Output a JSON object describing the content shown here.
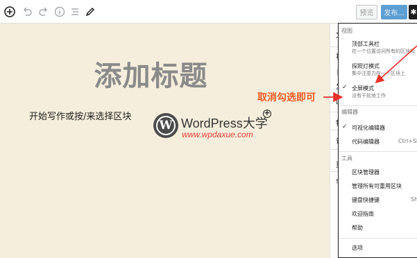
{
  "toolbar": {
    "icons": [
      "add-block-icon",
      "undo-icon",
      "redo-icon",
      "info-icon",
      "list-view-icon",
      "edit-icon"
    ],
    "preview_label": "预览",
    "publish_label": "发布...",
    "settings_icon": "gear-icon"
  },
  "editor": {
    "title_placeholder": "添加标题",
    "paragraph_placeholder": "开始写作或按/来选择区块",
    "add_block_symbol": "+"
  },
  "watermark": {
    "logo_letter": "W",
    "name": "WordPress大学",
    "url": "www.wpdaxue.com"
  },
  "annotation": {
    "text": "取消勾选即可",
    "color": "#f15a22"
  },
  "sidebar": {
    "fragments": [
      "文",
      "状",
      "台",
      "发",
      "[",
      "特",
      "讨",
      "页",
      "S"
    ]
  },
  "menu": {
    "groups": [
      {
        "label": "视图",
        "items": [
          {
            "label": "顶部工具栏",
            "description": "在一个位置访问所有的区块和",
            "checked": false
          },
          {
            "label": "探照灯模式",
            "description": "集中注意力在一个区块上",
            "checked": false
          },
          {
            "label": "全屏模式",
            "description": "没有干扰地工作",
            "checked": true
          }
        ]
      },
      {
        "label": "编辑器",
        "items": [
          {
            "label": "可视化编辑器",
            "checked": true,
            "shortcut": ""
          },
          {
            "label": "代码编辑器",
            "checked": false,
            "shortcut": "Ctrl+Shi"
          }
        ]
      },
      {
        "label": "工具",
        "items": [
          {
            "label": "区块管理器",
            "shortcut": ""
          },
          {
            "label": "管理所有可重用区块",
            "shortcut": ""
          },
          {
            "label": "键盘快捷键",
            "shortcut": "Shi"
          },
          {
            "label": "欢迎指南",
            "shortcut": ""
          },
          {
            "label": "帮助",
            "shortcut": ""
          }
        ]
      }
    ],
    "footer_item": "选项"
  }
}
